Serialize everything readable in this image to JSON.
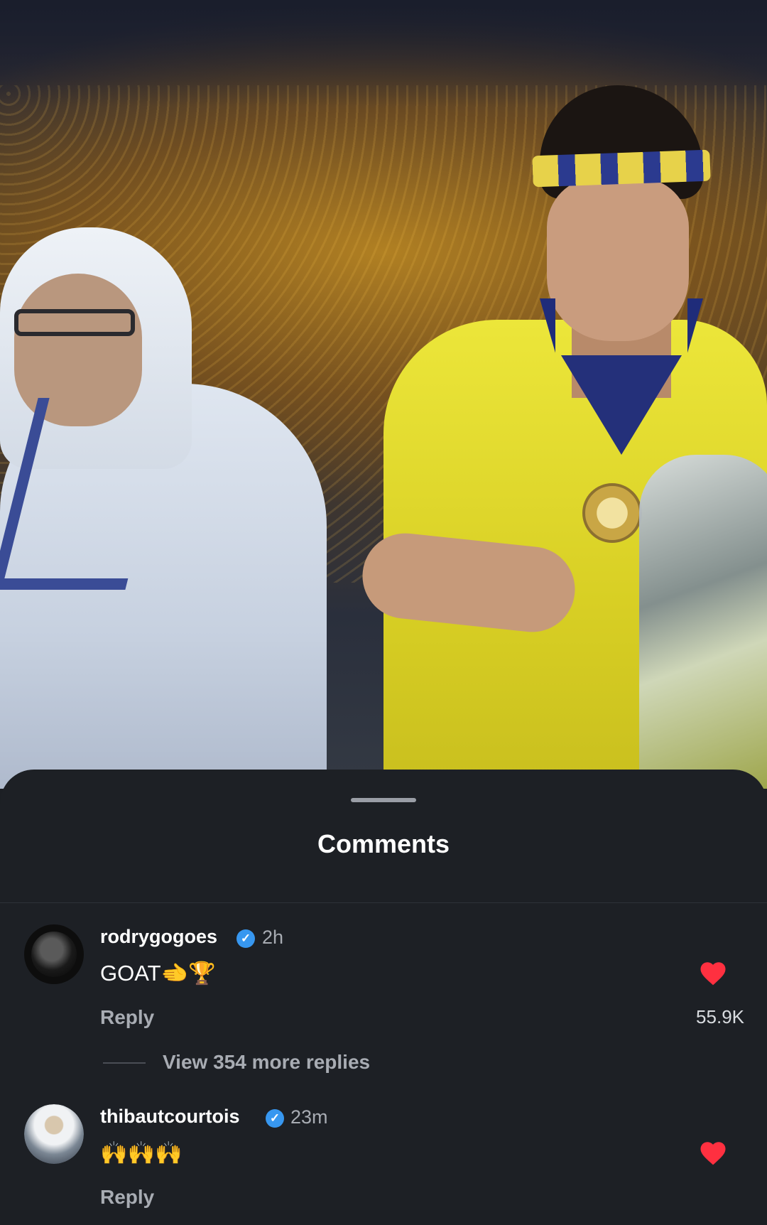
{
  "sheet": {
    "title": "Comments"
  },
  "comments": [
    {
      "username": "rodrygogoes",
      "verified": true,
      "time": "2h",
      "text": "GOAT🫲🏆",
      "reply_label": "Reply",
      "likes": "55.9K",
      "liked": true,
      "view_replies": "View 354 more replies"
    },
    {
      "username": "thibautcourtois",
      "verified": true,
      "time": "23m",
      "text": "🙌🙌🙌",
      "reply_label": "Reply",
      "likes": "",
      "liked": true
    }
  ],
  "colors": {
    "sheet_bg": "#1d2025",
    "verified_blue": "#3797f0",
    "heart_red": "#ff3040",
    "secondary_text": "#a8acb3"
  },
  "icons": [
    "verified-badge-icon",
    "heart-icon"
  ]
}
